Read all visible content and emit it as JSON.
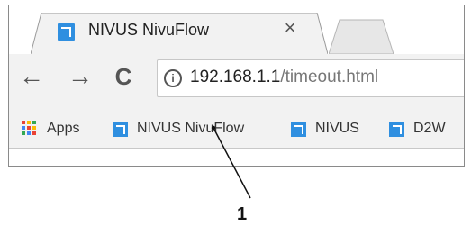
{
  "tab": {
    "title": "NIVUS NivuFlow",
    "close_glyph": "×",
    "favicon": "nivus-favicon"
  },
  "toolbar": {
    "back_glyph": "←",
    "forward_glyph": "→",
    "reload_glyph": "C",
    "info_glyph": "i",
    "url_host": "192.168.1.1",
    "url_path": "/timeout.html"
  },
  "bookmarks": [
    {
      "label": "Apps",
      "icon": "apps-grid-icon"
    },
    {
      "label": "NIVUS NivuFlow",
      "icon": "nivus-favicon"
    },
    {
      "label": "NIVUS",
      "icon": "nivus-favicon"
    },
    {
      "label": "D2W",
      "icon": "nivus-favicon"
    }
  ],
  "callout": {
    "label": "1"
  },
  "colors": {
    "favicon_blue": "#2f8fe0",
    "apps_dots": [
      "#e94235",
      "#fbbc05",
      "#34a853",
      "#4285f4",
      "#e94235",
      "#fbbc05",
      "#34a853",
      "#4285f4",
      "#e94235"
    ]
  }
}
